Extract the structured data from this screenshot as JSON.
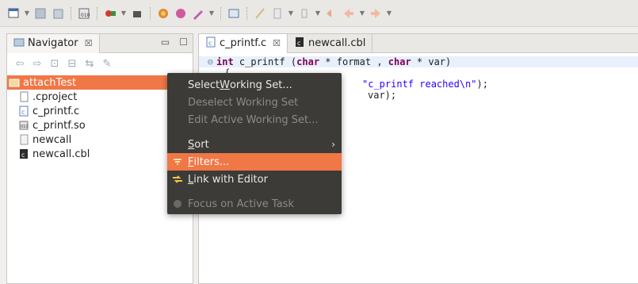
{
  "navigator": {
    "tab_label": "Navigator",
    "close_glyph": "☒",
    "tree": [
      {
        "label": "attachTest",
        "icon": "project-folder-icon",
        "selected": true
      },
      {
        "label": ".cproject",
        "icon": "file-icon"
      },
      {
        "label": "c_printf.c",
        "icon": "c-source-file-icon"
      },
      {
        "label": "c_printf.so",
        "icon": "shared-library-icon"
      },
      {
        "label": "newcall",
        "icon": "binary-file-icon"
      },
      {
        "label": "newcall.cbl",
        "icon": "cobol-file-icon"
      }
    ]
  },
  "editor": {
    "tabs": [
      {
        "label": "c_printf.c",
        "active": true,
        "close_glyph": "☒"
      },
      {
        "label": "newcall.cbl",
        "active": false
      }
    ],
    "code": {
      "line1_kw1": "int",
      "line1_fn": " c_printf (",
      "line1_kw2": "char",
      "line1_rest1": " * format , ",
      "line1_kw3": "char",
      "line1_rest2": " * var)",
      "line2": "{",
      "line3_str": "\"c_printf reached\\n\"",
      "line3_rest": ");",
      "line4": "var);"
    }
  },
  "menu": {
    "items": [
      {
        "pre": "Select ",
        "mnemonic": "W",
        "post": "orking Set...",
        "disabled": false
      },
      {
        "label": "Deselect Working Set",
        "disabled": true
      },
      {
        "label": "Edit Active Working Set...",
        "disabled": true
      },
      {
        "pre": "",
        "mnemonic": "S",
        "post": "ort",
        "submenu_glyph": "›",
        "disabled": false
      },
      {
        "pre": "",
        "mnemonic": "F",
        "post": "ilters...",
        "hover": true,
        "icon": "filters-icon"
      },
      {
        "pre": "",
        "mnemonic": "L",
        "post": "ink with Editor",
        "icon": "link-with-editor-icon"
      },
      {
        "label": "Focus on Active Task",
        "disabled": true,
        "icon": "focus-task-icon"
      }
    ]
  },
  "colors": {
    "accent": "#f07746",
    "menu_bg": "#3c3b37",
    "highlight_circle": "#e0312c"
  }
}
